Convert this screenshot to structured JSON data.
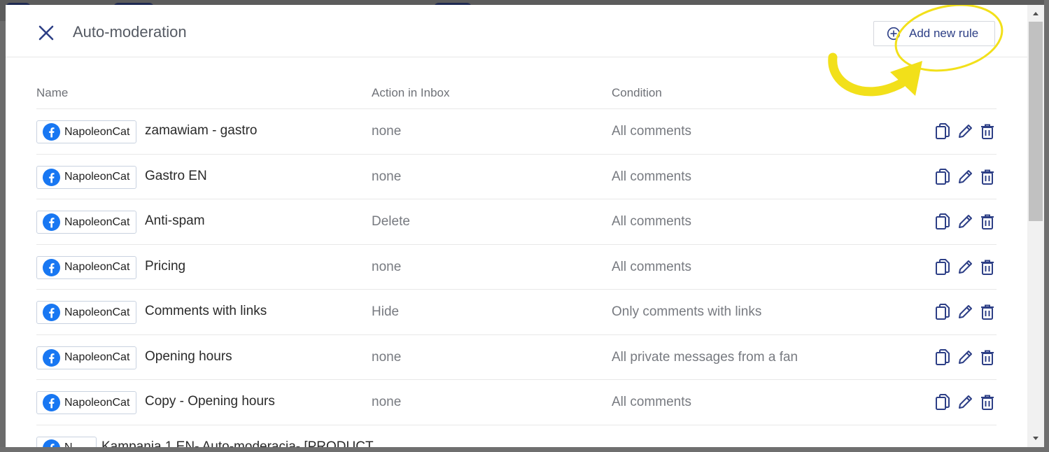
{
  "modal": {
    "title": "Auto-moderation",
    "add_button_label": "Add new rule"
  },
  "table": {
    "columns": [
      "Name",
      "Action in Inbox",
      "Condition"
    ],
    "rows": [
      {
        "account": "NapoleonCat",
        "name": "zamawiam - gastro",
        "action": "none",
        "condition": "All comments"
      },
      {
        "account": "NapoleonCat",
        "name": "Gastro EN",
        "action": "none",
        "condition": "All comments"
      },
      {
        "account": "NapoleonCat",
        "name": "Anti-spam",
        "action": "Delete",
        "condition": "All comments"
      },
      {
        "account": "NapoleonCat",
        "name": "Pricing",
        "action": "none",
        "condition": "All comments"
      },
      {
        "account": "NapoleonCat",
        "name": "Comments with links",
        "action": "Hide",
        "condition": "Only comments with links"
      },
      {
        "account": "NapoleonCat",
        "name": "Opening hours",
        "action": "none",
        "condition": "All private messages from a fan"
      },
      {
        "account": "NapoleonCat",
        "name": "Copy - Opening hours",
        "action": "none",
        "condition": "All comments"
      },
      {
        "account": "N",
        "name": "Kampania 1 EN- Auto-moderacja- [PRODUCT",
        "action": "",
        "condition": ""
      }
    ]
  },
  "colors": {
    "accent": "#2d3f86",
    "facebook": "#1877f2",
    "annotation": "#f2e01a"
  },
  "icons": [
    "close-icon",
    "plus-circle-icon",
    "facebook-icon",
    "copy-icon",
    "edit-pencil-icon",
    "trash-icon"
  ]
}
